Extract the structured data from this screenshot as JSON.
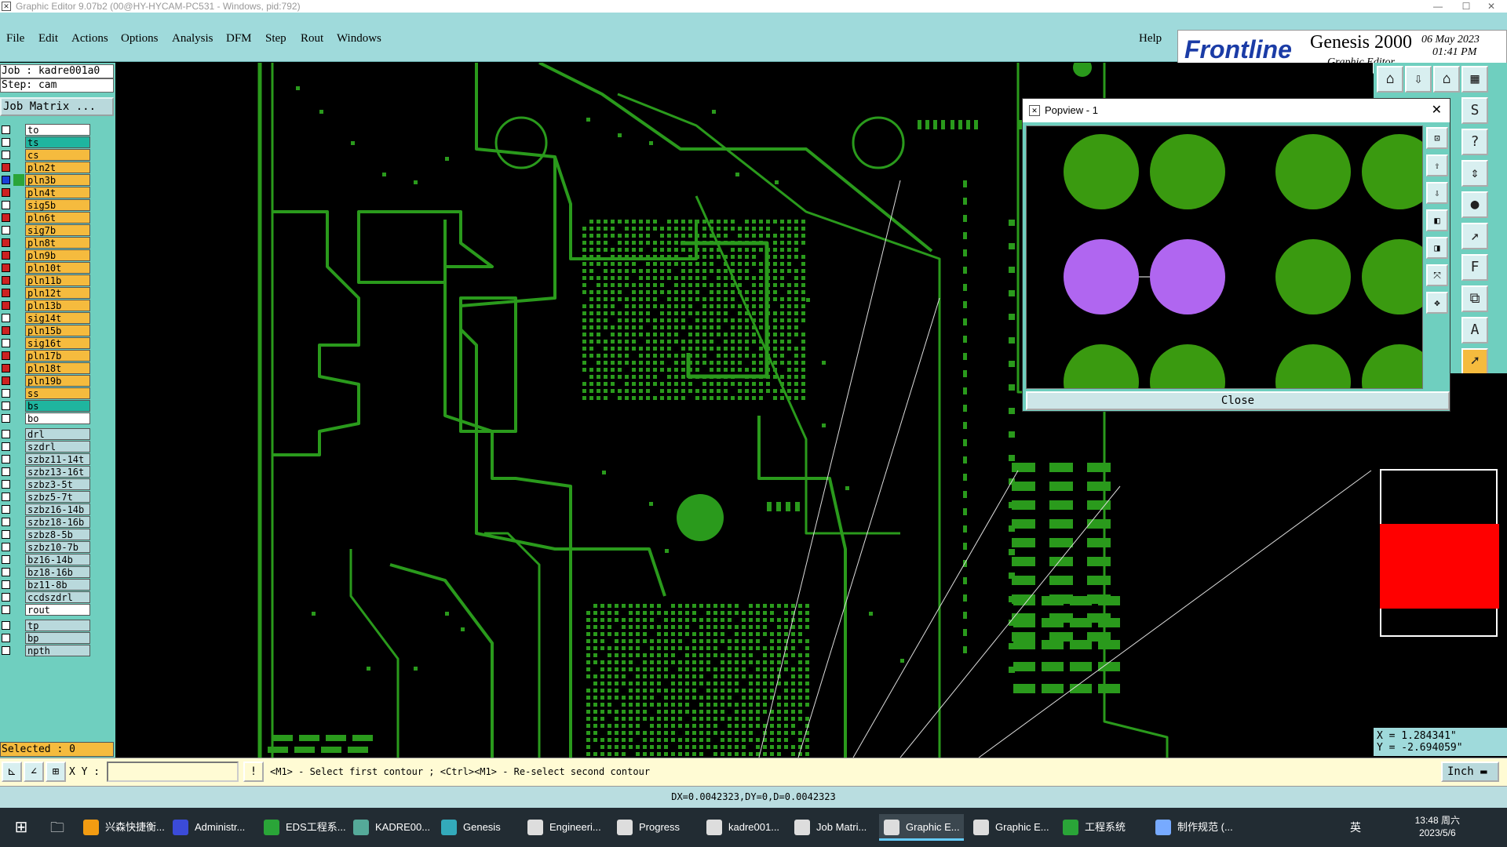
{
  "window": {
    "title": "Graphic Editor 9.07b2 (00@HY-HYCAM-PC531 - Windows, pid:792)",
    "min": "—",
    "max": "☐",
    "close": "✕"
  },
  "menu": [
    "File",
    "Edit",
    "Actions",
    "Options",
    "Analysis",
    "DFM",
    "Step",
    "Rout",
    "Windows"
  ],
  "help": "Help",
  "logo": {
    "brand": "Frontline",
    "product": "Genesis 2000",
    "subtitle": "Graphic Editor",
    "date": "06 May 2023",
    "time": "01:41 PM"
  },
  "job": {
    "job_line": "Job : kadre001a0",
    "step_line": "Step: cam",
    "matrix_button": "Job Matrix ..."
  },
  "layers": [
    {
      "name": "to",
      "color": "#ffffff",
      "bg": "#ffffff",
      "checked": false
    },
    {
      "name": "ts",
      "color": "#1fb59f",
      "bg": "#1fb59f",
      "checked": false
    },
    {
      "name": "cs",
      "color": "#f5bb3e",
      "bg": "#f5bb3e",
      "checked": false
    },
    {
      "name": "pln2t",
      "color": "#f5bb3e",
      "bg": "#f5bb3e",
      "checked": true
    },
    {
      "name": "pln3b",
      "color": "#2aa538",
      "bg": "#f5bb3e",
      "checked": true,
      "selected": true
    },
    {
      "name": "pln4t",
      "color": "#f5bb3e",
      "bg": "#f5bb3e",
      "checked": true
    },
    {
      "name": "sig5b",
      "color": "#f5bb3e",
      "bg": "#f5bb3e",
      "checked": false
    },
    {
      "name": "pln6t",
      "color": "#f5bb3e",
      "bg": "#f5bb3e",
      "checked": true
    },
    {
      "name": "sig7b",
      "color": "#f5bb3e",
      "bg": "#f5bb3e",
      "checked": false
    },
    {
      "name": "pln8t",
      "color": "#f5bb3e",
      "bg": "#f5bb3e",
      "checked": true
    },
    {
      "name": "pln9b",
      "color": "#f5bb3e",
      "bg": "#f5bb3e",
      "checked": true
    },
    {
      "name": "pln10t",
      "color": "#f5bb3e",
      "bg": "#f5bb3e",
      "checked": true
    },
    {
      "name": "pln11b",
      "color": "#f5bb3e",
      "bg": "#f5bb3e",
      "checked": true
    },
    {
      "name": "pln12t",
      "color": "#f5bb3e",
      "bg": "#f5bb3e",
      "checked": true
    },
    {
      "name": "pln13b",
      "color": "#f5bb3e",
      "bg": "#f5bb3e",
      "checked": true
    },
    {
      "name": "sig14t",
      "color": "#f5bb3e",
      "bg": "#f5bb3e",
      "checked": false
    },
    {
      "name": "pln15b",
      "color": "#f5bb3e",
      "bg": "#f5bb3e",
      "checked": true
    },
    {
      "name": "sig16t",
      "color": "#f5bb3e",
      "bg": "#f5bb3e",
      "checked": false
    },
    {
      "name": "pln17b",
      "color": "#f5bb3e",
      "bg": "#f5bb3e",
      "checked": true
    },
    {
      "name": "pln18t",
      "color": "#f5bb3e",
      "bg": "#f5bb3e",
      "checked": true
    },
    {
      "name": "pln19b",
      "color": "#f5bb3e",
      "bg": "#f5bb3e",
      "checked": true
    },
    {
      "name": "ss",
      "color": "#f5bb3e",
      "bg": "#f5bb3e",
      "checked": false
    },
    {
      "name": "bs",
      "color": "#1fb59f",
      "bg": "#1fb59f",
      "checked": false
    },
    {
      "name": "bo",
      "color": "#ffffff",
      "bg": "#ffffff",
      "checked": false
    }
  ],
  "drill_layers": [
    {
      "name": "drl",
      "bg": "#b9d9dc"
    },
    {
      "name": "szdrl",
      "bg": "#b9d9dc"
    },
    {
      "name": "szbz11-14t",
      "bg": "#b9d9dc"
    },
    {
      "name": "szbz13-16t",
      "bg": "#b9d9dc"
    },
    {
      "name": "szbz3-5t",
      "bg": "#b9d9dc"
    },
    {
      "name": "szbz5-7t",
      "bg": "#b9d9dc"
    },
    {
      "name": "szbz16-14b",
      "bg": "#b9d9dc"
    },
    {
      "name": "szbz18-16b",
      "bg": "#b9d9dc"
    },
    {
      "name": "szbz8-5b",
      "bg": "#b9d9dc"
    },
    {
      "name": "szbz10-7b",
      "bg": "#b9d9dc"
    },
    {
      "name": "bz16-14b",
      "bg": "#b9d9dc"
    },
    {
      "name": "bz18-16b",
      "bg": "#b9d9dc"
    },
    {
      "name": "bz11-8b",
      "bg": "#b9d9dc"
    },
    {
      "name": "ccdszdrl",
      "bg": "#b9d9dc"
    },
    {
      "name": "rout",
      "bg": "#ffffff"
    }
  ],
  "misc_layers": [
    {
      "name": "tp",
      "bg": "#b9d9dc"
    },
    {
      "name": "bp",
      "bg": "#b9d9dc"
    },
    {
      "name": "npth",
      "bg": "#b9d9dc"
    }
  ],
  "selected_count": "Selected : 0",
  "popview": {
    "title": "Popview - 1",
    "close_x": "✕",
    "close_button": "Close"
  },
  "coords": {
    "x": "X = 1.284341\"",
    "y": "Y = -2.694059\""
  },
  "bottom": {
    "xy_label": "X Y :",
    "xy_value": "",
    "hint": "<M1> - Select first contour ; <Ctrl><M1> - Re-select second contour",
    "unit": "Inch"
  },
  "status": "DX=0.0042323,DY=0,D=0.0042323",
  "taskbar": {
    "items": [
      {
        "label": "兴森快捷衡...",
        "color": "#f39c12"
      },
      {
        "label": "Administr...",
        "color": "#3b4bd8"
      },
      {
        "label": "EDS工程系...",
        "color": "#2aa538"
      },
      {
        "label": "KADRE00...",
        "color": "#5a9"
      },
      {
        "label": "Genesis",
        "color": "#3ab"
      },
      {
        "label": "Engineeri...",
        "color": "#ddd"
      },
      {
        "label": "Progress",
        "color": "#ddd"
      },
      {
        "label": "kadre001...",
        "color": "#ddd"
      },
      {
        "label": "Job Matri...",
        "color": "#ddd"
      },
      {
        "label": "Graphic E...",
        "color": "#ddd",
        "active": true
      },
      {
        "label": "Graphic E...",
        "color": "#ddd"
      },
      {
        "label": "工程系统",
        "color": "#2aa538"
      },
      {
        "label": "制作规范 (...",
        "color": "#7af"
      }
    ],
    "ime": "英",
    "time": "13:48 周六",
    "date": "2023/5/6"
  },
  "colors": {
    "trace": "#2a9a1c",
    "pad": "#3a9a10",
    "highlight": "#b066f0",
    "ui_bg": "#9fdadb",
    "panel": "#6fcfbf"
  }
}
